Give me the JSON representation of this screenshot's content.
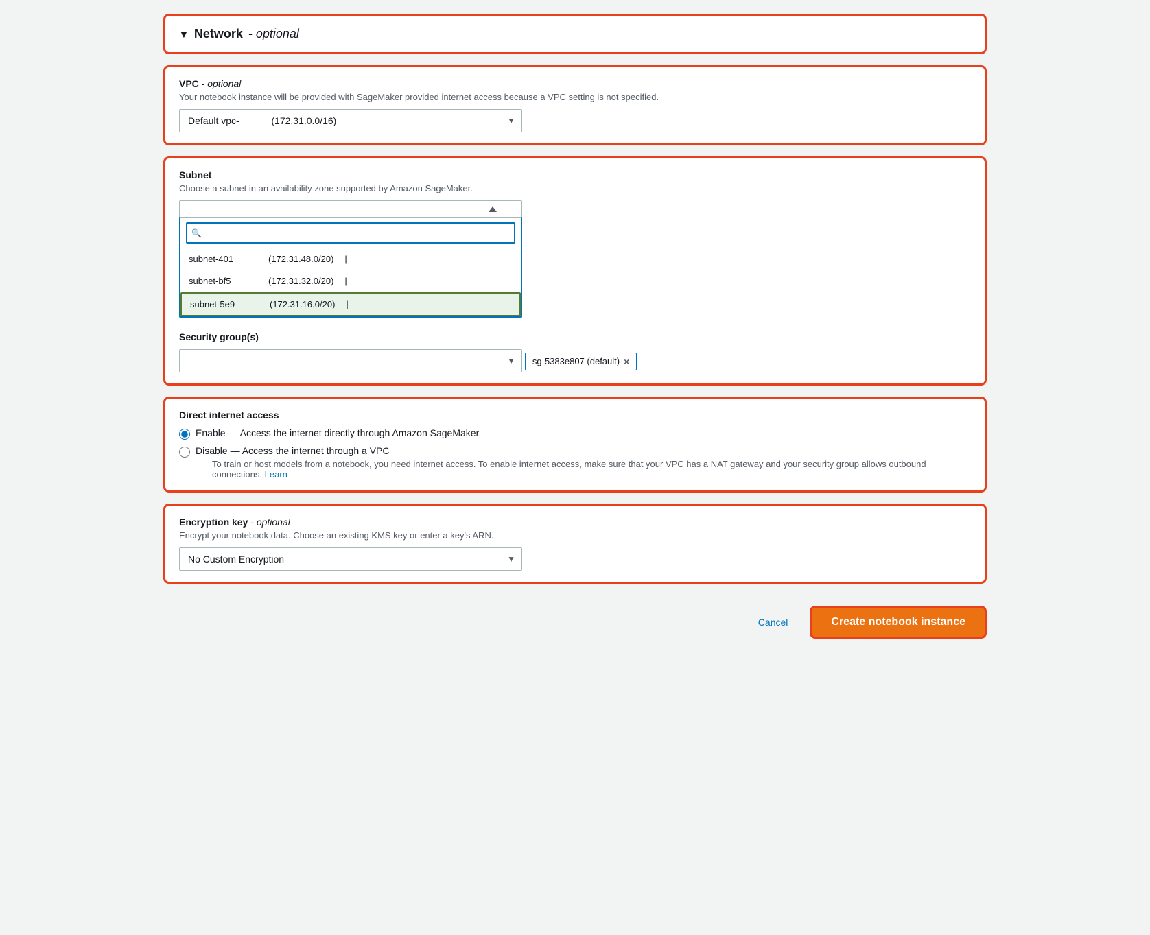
{
  "network_section": {
    "title": "Network",
    "title_suffix": "- optional",
    "collapse_arrow": "▼"
  },
  "vpc_section": {
    "label": "VPC",
    "label_suffix": "- optional",
    "description": "Your notebook instance will be provided with SageMaker provided internet access because a VPC setting is not specified.",
    "selected_value": "Default vpc-",
    "selected_cidr": "(172.31.0.0/16)"
  },
  "subnet_section": {
    "label": "Subnet",
    "description": "Choose a subnet in an availability zone supported by Amazon SageMaker.",
    "search_placeholder": "",
    "options": [
      {
        "name": "subnet-401",
        "cidr": "(172.31.48.0/20)"
      },
      {
        "name": "subnet-bf5",
        "cidr": "(172.31.32.0/20)"
      },
      {
        "name": "subnet-5e9",
        "cidr": "(172.31.16.0/20)"
      }
    ],
    "selected_index": 2
  },
  "security_group_section": {
    "label": "Security group(s)",
    "badge_text": "sg-5383e807 (default)",
    "close_label": "×"
  },
  "direct_internet_section": {
    "label": "Direct internet access",
    "options": [
      {
        "label": "Enable — Access the internet directly through Amazon SageMaker",
        "selected": true
      },
      {
        "label": "Disable — Access the internet through a VPC",
        "selected": false,
        "description": "To train or host models from a notebook, you need internet access. To enable internet access, make sure that your VPC has a NAT gateway and your security group allows outbound connections.",
        "learn_more": "Learn"
      }
    ]
  },
  "encryption_section": {
    "label": "Encryption key",
    "label_suffix": "- optional",
    "description": "Encrypt your notebook data. Choose an existing KMS key or enter a key's ARN.",
    "selected_value": "No Custom Encryption"
  },
  "footer": {
    "cancel_label": "Cancel",
    "create_label": "Create notebook instance"
  }
}
